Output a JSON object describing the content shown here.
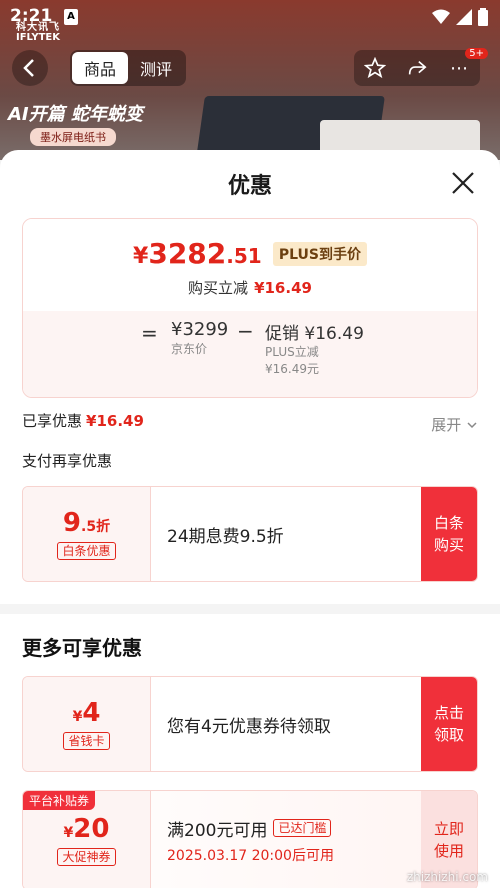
{
  "status_bar": {
    "time": "2:21",
    "notification_icon": "A"
  },
  "background": {
    "brand_line1": "科大讯飞",
    "brand_line2": "IFLYTEK",
    "promo_title": "AI开篇 蛇年蜕变",
    "promo_sub": "墨水屏电纸书"
  },
  "navbar": {
    "tabs": [
      {
        "label": "商品"
      },
      {
        "label": "测评"
      }
    ],
    "badge": "5+"
  },
  "sheet": {
    "title": "优惠",
    "price_card": {
      "currency": "¥",
      "price_int": "3282",
      "price_dec": ".51",
      "plus_tag": "PLUS到手价",
      "instant_label": "购买立减",
      "instant_value": "¥16.49",
      "eq": "=",
      "jd_price": "¥3299",
      "jd_label": "京东价",
      "minus": "−",
      "promo_value": "促销 ¥16.49",
      "promo_line1": "PLUS立减",
      "promo_line2": "¥16.49元"
    },
    "enjoyed_label": "已享优惠",
    "enjoyed_value": "¥16.49",
    "expand_label": "展开",
    "pay_more_label": "支付再享优惠",
    "baitiao": {
      "amount_big": "9",
      "amount_small": ".5折",
      "tag": "白条优惠",
      "desc": "24期息费9.5折",
      "button": "白条购买"
    },
    "more_title": "更多可享优惠",
    "coupon_save": {
      "currency": "¥",
      "amount": "4",
      "tag": "省钱卡",
      "desc": "您有4元优惠券待领取",
      "button": "点击领取"
    },
    "coupon_platform": {
      "ribbon": "平台补贴券",
      "currency": "¥",
      "amount": "20",
      "tag": "大促神券",
      "condition": "满200元可用",
      "reached": "已达门槛",
      "when": "2025.03.17 20:00后可用",
      "button": "立即使用"
    }
  },
  "watermark": "zhizhizhi.com",
  "colors": {
    "accent": "#e1251b",
    "button": "#f0303a",
    "plus_bg": "#fbe9c9"
  }
}
